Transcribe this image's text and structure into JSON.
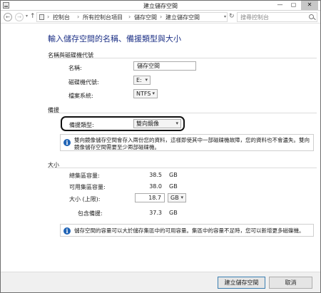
{
  "window": {
    "title": "建立儲存空間"
  },
  "controls": {
    "minimize": "—",
    "maximize": "▢",
    "close": "✕"
  },
  "nav": {
    "back": "←",
    "forward": "→",
    "dropdown": "▾",
    "up": "↑",
    "refresh": "↻"
  },
  "breadcrumb": {
    "sep1": "›",
    "item1": "控制台",
    "sep2": "›",
    "item2": "所有控制台項目",
    "sep3": "›",
    "item3": "儲存空間",
    "sep4": "›",
    "item4": "建立儲存空間",
    "dropdown": "▾"
  },
  "search": {
    "placeholder": "搜尋控制台"
  },
  "page": {
    "heading": "輸入儲存空間的名稱、備援類型與大小"
  },
  "name_section": {
    "heading": "名稱與磁碟機代號",
    "name_label": "名稱:",
    "name_value": "儲存空間",
    "drive_label": "磁碟機代號:",
    "drive_value": "E:",
    "fs_label": "檔案系統:",
    "fs_value": "NTFS"
  },
  "resiliency": {
    "heading": "備援",
    "type_label": "備援類型:",
    "type_value": "雙向鏡像",
    "info_icon": "i",
    "info": "雙向鏡像儲存空間會存入兩份您的資料，這樣即使其中一部磁碟機故障，您的資料也不會遺失。雙向鏡像儲存空間需要至少兩部磁碟機。"
  },
  "size": {
    "heading": "大小",
    "total_label": "總集區容量:",
    "total_value": "38.5",
    "total_unit": "GB",
    "avail_label": "可用集區容量:",
    "avail_value": "38.0",
    "avail_unit": "GB",
    "max_label": "大小 (上限):",
    "max_value": "18.7",
    "max_unit": "GB",
    "resil_label": "包含備援:",
    "resil_value": "37.3",
    "resil_unit": "GB",
    "info_icon": "i",
    "info": "儲存空間的容量可以大於儲存集區中的可用容量。集區中的容量不足時，您可以新增更多磁碟機。"
  },
  "buttons": {
    "create": "建立儲存空間",
    "cancel": "取消"
  },
  "colors": {
    "heading": "#1e3287",
    "info_icon": "#1f63b5"
  }
}
